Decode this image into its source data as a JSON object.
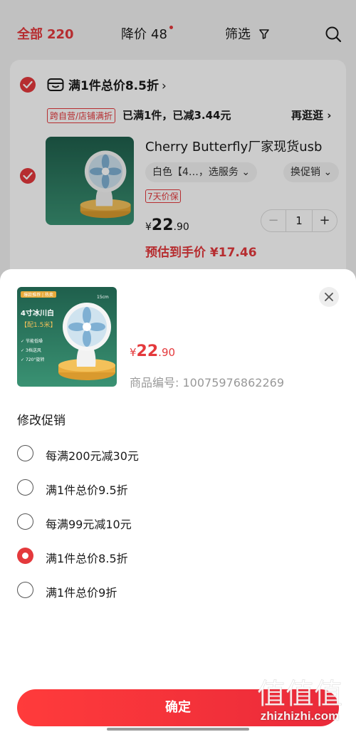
{
  "header": {
    "tab_all": "全部",
    "tab_all_count": "220",
    "tab_price_drop": "降价",
    "tab_price_drop_count": "48",
    "tab_filter": "筛选"
  },
  "shop": {
    "title": "满1件总价8.5折",
    "title_arrow": "›",
    "promo_tag": "跨自营/店铺满折",
    "promo_text": "已满1件，已减3.44元",
    "more": "再逛逛 ›"
  },
  "item": {
    "title": "Cherry Butterfly厂家现货usb",
    "spec": "白色【4…，选服务 ⌄",
    "promo": "换促销 ⌄",
    "protect": "7天价保",
    "price_currency": "¥",
    "price_int": "22",
    "price_dec": ".90",
    "estimate": "预估到手价 ¥17.46",
    "qty_minus": "−",
    "qty": "1",
    "qty_plus": "+"
  },
  "product_image": {
    "badge": "爆款推荐 | 热卖",
    "size_label": "4寸冰川白",
    "cable": "【配1.5米】",
    "features": [
      "节能低噪",
      "3档送风",
      "720°旋转"
    ],
    "measure": "15cm"
  },
  "sheet": {
    "price_currency": "¥",
    "price_int": "22",
    "price_dec": ".90",
    "sku": "商品编号: 10075976862269",
    "section_title": "修改促销",
    "options": [
      {
        "label": "每满200元减30元",
        "selected": false
      },
      {
        "label": "满1件总价9.5折",
        "selected": false
      },
      {
        "label": "每满99元减10元",
        "selected": false
      },
      {
        "label": "满1件总价8.5折",
        "selected": true
      },
      {
        "label": "满1件总价9折",
        "selected": false
      }
    ],
    "confirm": "确定"
  },
  "watermark": {
    "glyphs": "值值值",
    "text": "zhizhizhi.com"
  },
  "colors": {
    "accent": "#e4393c",
    "fan_bg": "#2e7d63",
    "fan_base": "#e8a93a"
  }
}
